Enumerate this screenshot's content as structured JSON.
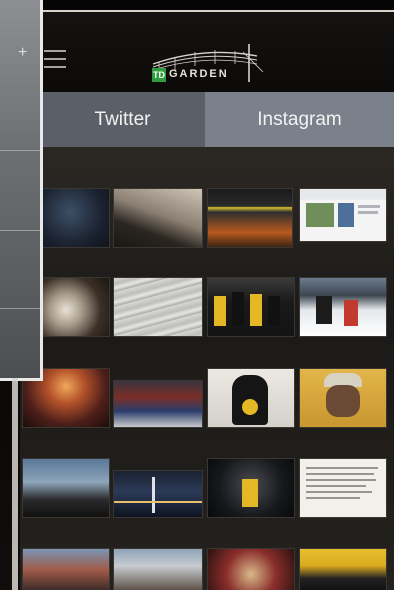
{
  "header": {
    "nav_ghost": "",
    "logo_text": "GARDEN",
    "logo_badge": "TD"
  },
  "tabs": [
    {
      "label": "Twitter",
      "active": false
    },
    {
      "label": "Instagram",
      "active": true
    }
  ],
  "overlay": {
    "plus_icon": "+"
  },
  "photos": [
    {
      "name": "photo-arena-night"
    },
    {
      "name": "photo-building-sky"
    },
    {
      "name": "photo-storefront"
    },
    {
      "name": "photo-web-screenshot"
    },
    {
      "name": "photo-helmet"
    },
    {
      "name": "photo-tickets"
    },
    {
      "name": "photo-hockey-team"
    },
    {
      "name": "photo-hockey-game"
    },
    {
      "name": "photo-concert-stage"
    },
    {
      "name": "photo-hockey-crowd"
    },
    {
      "name": "photo-player-portrait"
    },
    {
      "name": "photo-man-cap"
    },
    {
      "name": "photo-city-skyline"
    },
    {
      "name": "photo-bridge-night"
    },
    {
      "name": "photo-player-celebrate"
    },
    {
      "name": "photo-text-note"
    },
    {
      "name": "photo-street"
    },
    {
      "name": "photo-building-exterior"
    },
    {
      "name": "photo-bracelet"
    },
    {
      "name": "photo-team-poster"
    }
  ],
  "colors": {
    "tab_active": "#7b818a",
    "tab_inactive": "#5b6068",
    "td_green": "#2e9b3c"
  }
}
